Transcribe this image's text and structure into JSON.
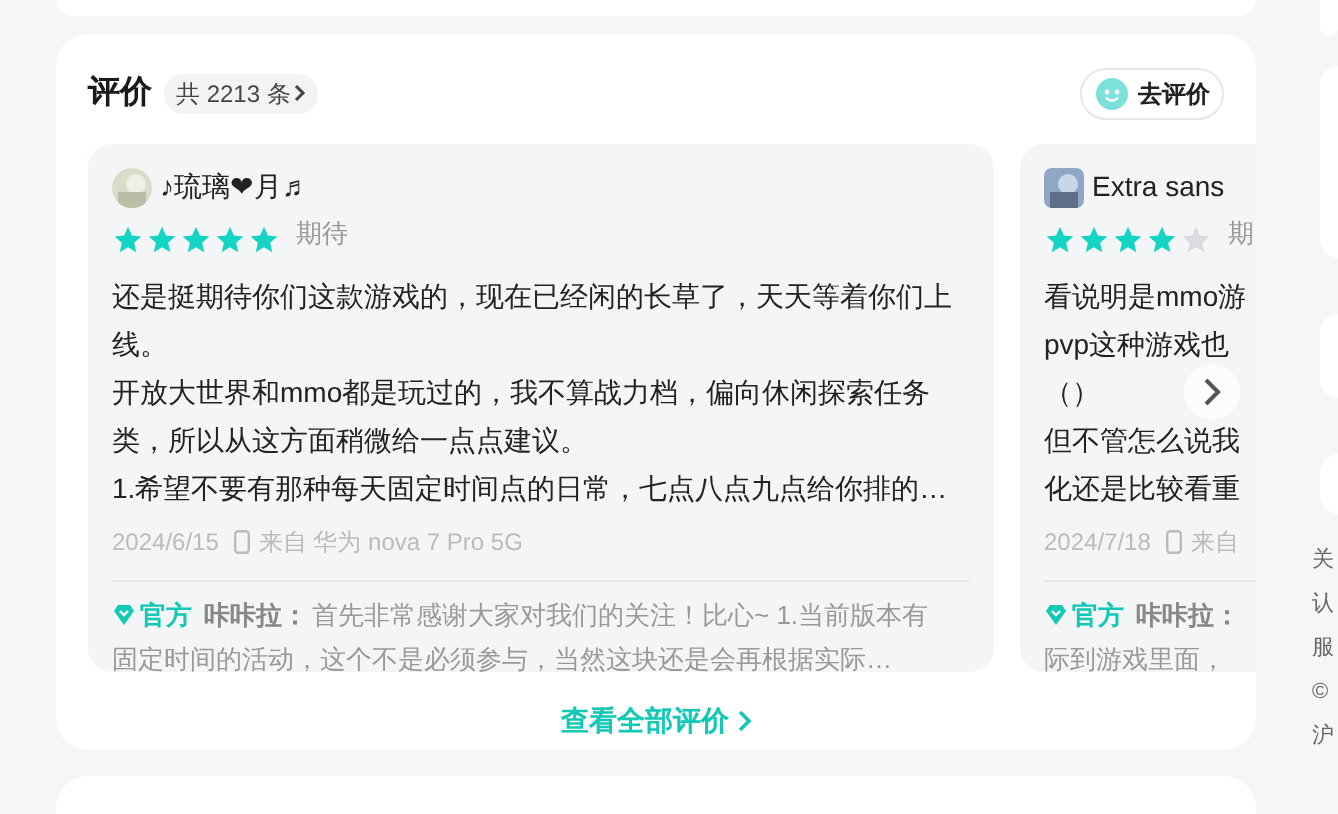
{
  "reviews_section": {
    "title": "评价",
    "count_badge": "共 2213 条",
    "write_button": "去评价",
    "reviews": [
      {
        "name": "♪琉璃❤月♬",
        "stars": 5,
        "tag": "期待",
        "lines": [
          "还是挺期待你们这款游戏的，现在已经闲的长草了，天天等着你们上",
          "线。",
          "开放大世界和mmo都是玩过的，我不算战力档，偏向休闲探索任务",
          "类，所以从这方面稍微给一点点建议。",
          "1.希望不要有那种每天固定时间点的日常，七点八点九点给你排的…"
        ],
        "date": "2024/6/15",
        "device": "来自 华为 nova 7 Pro 5G",
        "reply": {
          "badge": "官方",
          "author": "咔咔拉：",
          "lead": "首先非常感谢大家对我们的关注！比心~ 1.当前版本有",
          "rest": "固定时间的活动，这个不是必须参与，当然这块还是会再根据实际…"
        }
      },
      {
        "name": "Extra sans",
        "stars": 4,
        "tag": "期",
        "lines": [
          "看说明是mmo游",
          "pvp这种游戏也",
          "（）",
          "但不管怎么说我",
          "化还是比较看重"
        ],
        "date": "2024/7/18",
        "device": "来自",
        "reply": {
          "badge": "官方",
          "author": "咔咔拉：",
          "rest": "际到游戏里面，"
        }
      }
    ],
    "view_all": "查看全部评价"
  },
  "sidebar_footer": [
    "关",
    "认",
    "服",
    "©",
    "沪"
  ]
}
